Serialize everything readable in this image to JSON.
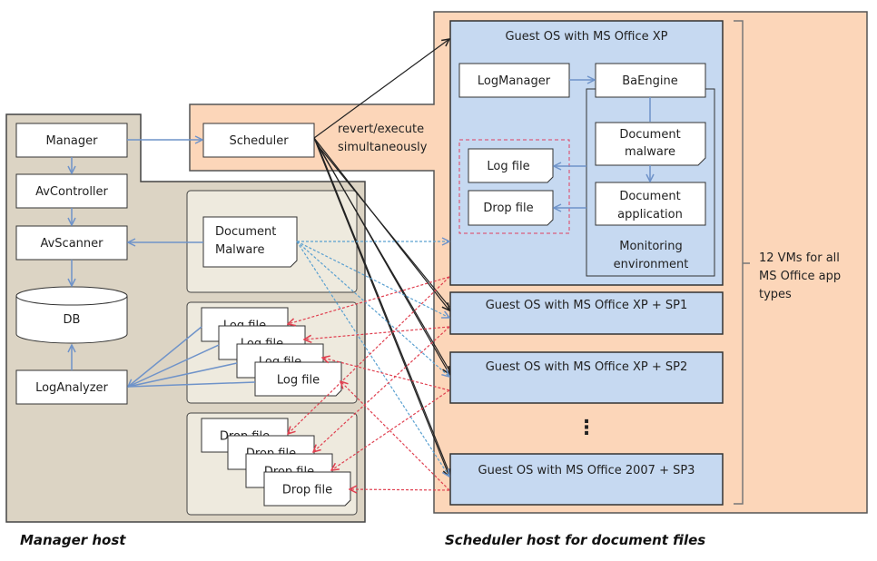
{
  "colors": {
    "manager_host": "#dcd4c4",
    "panel": "#eeeade",
    "scheduler_host": "#fcd6b9",
    "guest": "#c6d9f1",
    "blue_arrow": "#6f93c9",
    "red_arrow": "#e04050",
    "black_arrow": "#222222"
  },
  "manager_host": {
    "label": "Manager host",
    "manager": "Manager",
    "av_controller": "AvController",
    "av_scanner": "AvScanner",
    "db": "DB",
    "log_analyzer": "LogAnalyzer",
    "document_malware": [
      "Document",
      "Malware"
    ],
    "log_file": "Log file",
    "drop_file": "Drop file"
  },
  "scheduler": {
    "label": "Scheduler",
    "note": [
      "revert/execute",
      "simultaneously"
    ]
  },
  "scheduler_host": {
    "label": "Scheduler host for document files",
    "guest_main": {
      "title": "Guest OS with MS Office XP",
      "log_manager": "LogManager",
      "ba_engine": "BaEngine",
      "document_malware": [
        "Document",
        "malware"
      ],
      "document_application": [
        "Document",
        "application"
      ],
      "monitoring": [
        "Monitoring",
        "environment"
      ],
      "log_file": "Log file",
      "drop_file": "Drop file"
    },
    "guests": [
      "Guest OS with MS Office XP + SP1",
      "Guest OS with MS Office XP + SP2",
      "Guest OS with MS Office 2007 + SP3"
    ],
    "ellipsis": "⋮",
    "vm_note": [
      "12 VMs for all",
      "MS Office app",
      "types"
    ]
  }
}
